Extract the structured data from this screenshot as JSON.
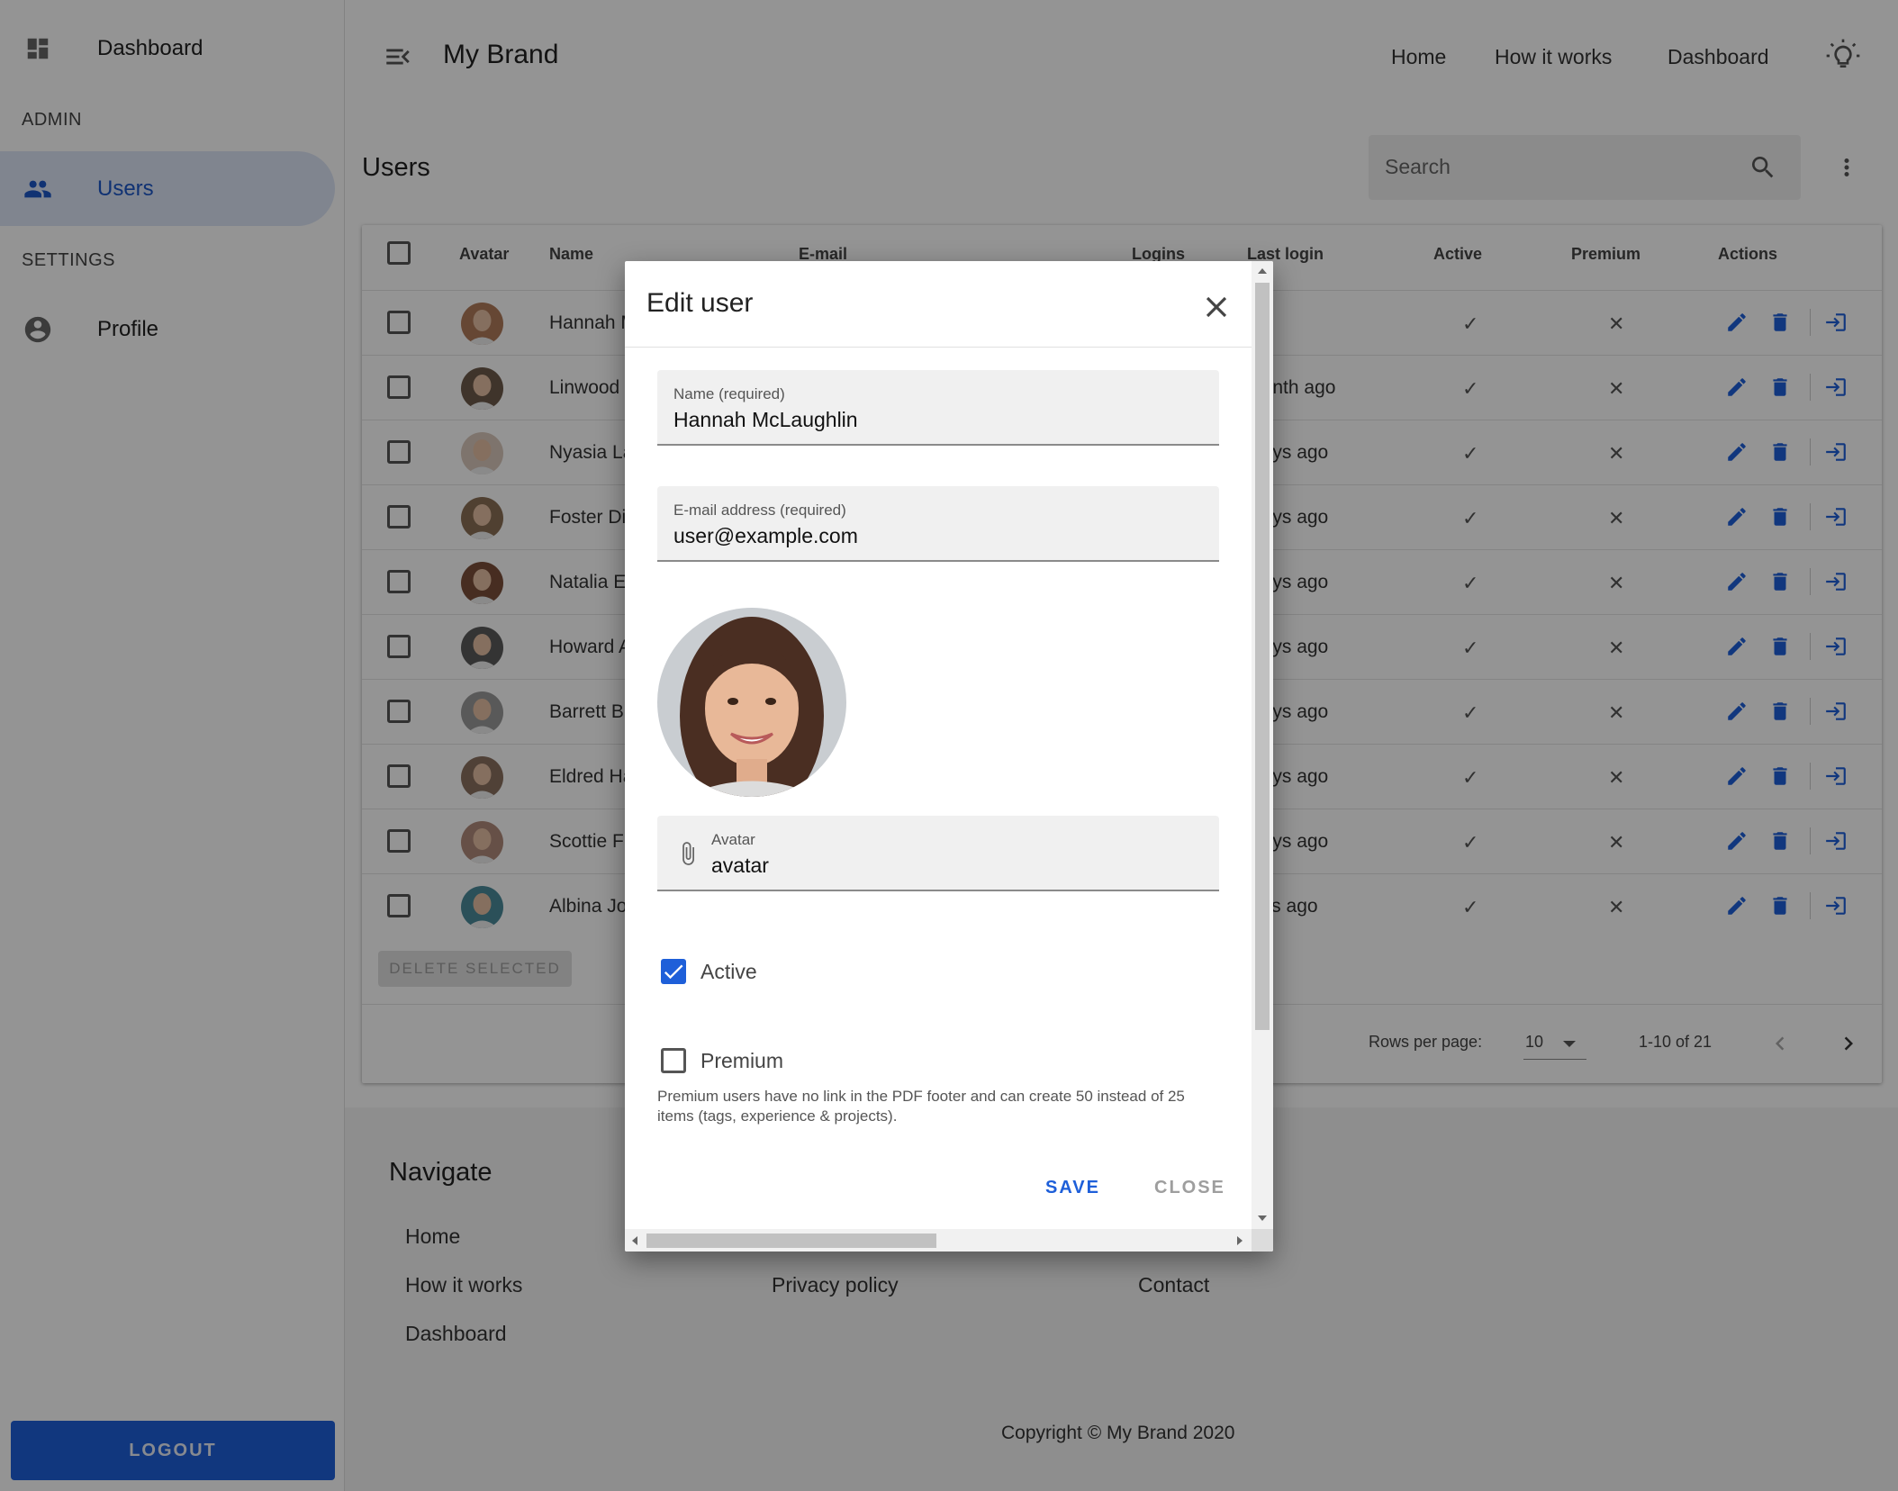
{
  "sidebar": {
    "dashboard_label": "Dashboard",
    "admin_header": "ADMIN",
    "users_label": "Users",
    "settings_header": "SETTINGS",
    "profile_label": "Profile",
    "logout_label": "LOGOUT"
  },
  "header": {
    "brand": "My Brand",
    "nav": [
      "Home",
      "How it works",
      "Dashboard"
    ]
  },
  "page": {
    "title": "Users",
    "search_placeholder": "Search"
  },
  "table": {
    "columns": [
      "Avatar",
      "Name",
      "E-mail",
      "Logins",
      "Last login",
      "Active",
      "Premium",
      "Actions"
    ],
    "rows": [
      {
        "name": "Hannah M",
        "last_login": ""
      },
      {
        "name": "Linwood",
        "last_login": "nonth ago"
      },
      {
        "name": "Nyasia La",
        "last_login": "days ago"
      },
      {
        "name": "Foster Di",
        "last_login": "days ago"
      },
      {
        "name": "Natalia E",
        "last_login": "days ago"
      },
      {
        "name": "Howard A",
        "last_login": "days ago"
      },
      {
        "name": "Barrett B",
        "last_login": "days ago"
      },
      {
        "name": "Eldred Ha",
        "last_login": "days ago"
      },
      {
        "name": "Scottie F",
        "last_login": "days ago"
      },
      {
        "name": "Albina Jo",
        "last_login": "ays ago"
      }
    ],
    "active_mark": "✓",
    "premium_mark": "✕",
    "delete_selected": "DELETE SELECTED",
    "rows_per_page_label": "Rows per page:",
    "rows_per_page_value": "10",
    "range": "1-10 of 21"
  },
  "footer": {
    "navigate": "Navigate",
    "links_col1": [
      "Home",
      "How it works",
      "Dashboard"
    ],
    "privacy": "Privacy policy",
    "contact": "Contact",
    "copyright": "Copyright © My Brand 2020"
  },
  "dialog": {
    "title": "Edit user",
    "name_label": "Name (required)",
    "name_value": "Hannah McLaughlin",
    "email_label": "E-mail address (required)",
    "email_value": "user@example.com",
    "avatar_label": "Avatar",
    "avatar_value": "avatar",
    "active_label": "Active",
    "active_checked": true,
    "premium_label": "Premium",
    "premium_checked": false,
    "premium_hint": "Premium users have no link in the PDF footer and can create 50 instead of 25 items (tags, experience & projects).",
    "save_label": "SAVE",
    "close_label": "CLOSE"
  },
  "colors": {
    "accent": "#1e5fd9",
    "active_nav_bg": "#dde5f7",
    "overlay": "rgba(0,0,0,0.42)"
  },
  "icons": [
    "dashboard-icon",
    "users-icon",
    "account-circle-icon",
    "menu-open-icon",
    "lightbulb-icon",
    "search-icon",
    "more-vert-icon",
    "edit-icon",
    "delete-icon",
    "login-icon",
    "close-icon",
    "paperclip-icon",
    "check-icon",
    "chevron-left-icon",
    "chevron-right-icon",
    "arrow-drop-down-icon"
  ]
}
